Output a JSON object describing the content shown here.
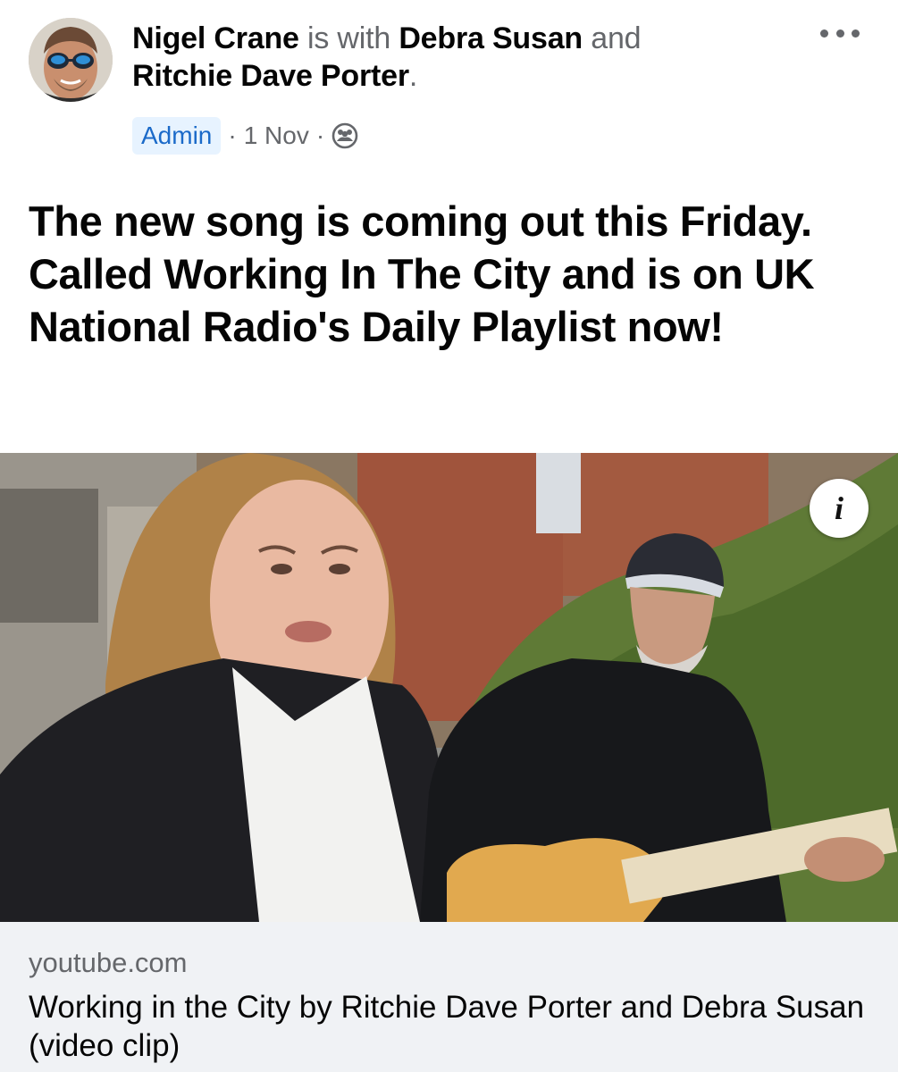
{
  "post": {
    "author": "Nigel Crane",
    "with_text": "is with",
    "tagged_1": "Debra Susan",
    "and_text": "and",
    "tagged_2": "Ritchie Dave Porter",
    "period": ".",
    "badge": "Admin",
    "separator": "·",
    "date": "1 Nov",
    "audience_icon": "group-icon",
    "more_icon": "more-horizontal-icon",
    "text": "The new song is coming out this Friday.  Called Working In The City and is on UK National Radio's Daily Playlist now!"
  },
  "video": {
    "info_glyph": "i"
  },
  "link": {
    "domain": "youtube.com",
    "title": "Working in the City by Ritchie Dave Porter and Debra Susan (video clip)"
  },
  "colors": {
    "text_primary": "#050505",
    "text_secondary": "#65676b",
    "badge_bg": "#e7f3ff",
    "badge_text": "#1b6ac9",
    "footer_bg": "#f0f2f5"
  }
}
